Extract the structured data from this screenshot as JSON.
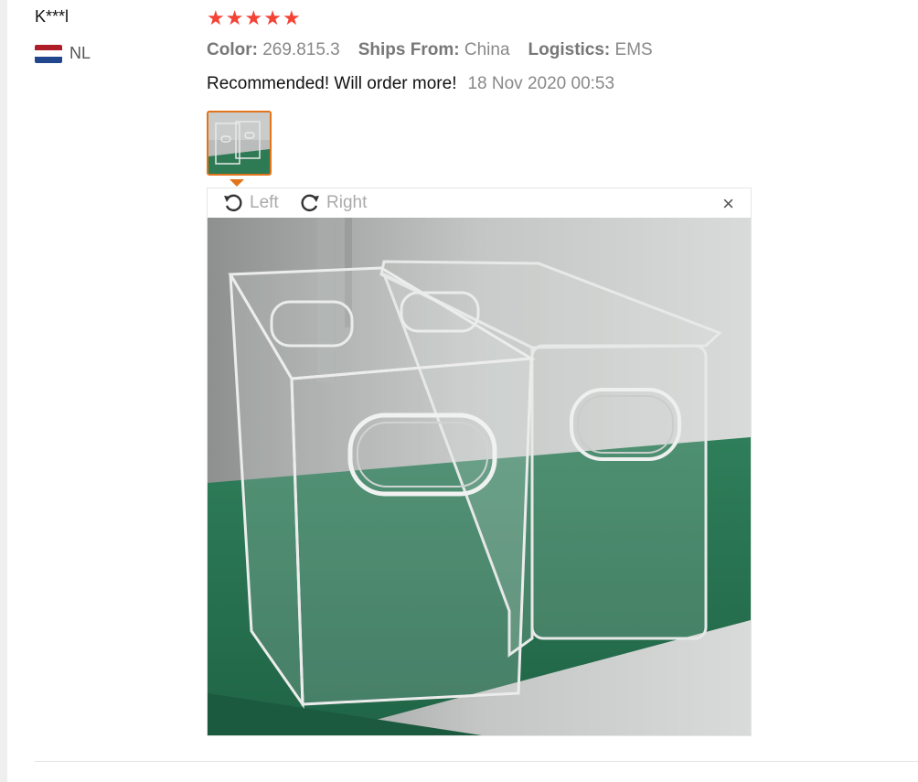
{
  "user": {
    "name": "K***l",
    "country_code": "NL"
  },
  "rating": {
    "stars": 5,
    "max": 5,
    "color": "#f44336"
  },
  "meta": [
    {
      "label": "Color:",
      "value": "269.815.3"
    },
    {
      "label": "Ships From:",
      "value": "China"
    },
    {
      "label": "Logistics:",
      "value": "EMS"
    }
  ],
  "review": {
    "text": "Recommended! Will order more!",
    "date": "18 Nov 2020 00:53"
  },
  "viewer": {
    "rotate_left_label": "Left",
    "rotate_right_label": "Right",
    "close_symbol": "×",
    "icons": [
      "rotate-left-icon",
      "rotate-right-icon",
      "close-icon"
    ]
  },
  "colors": {
    "accent": "#e2741b",
    "star": "#f44336",
    "muted": "#888888"
  }
}
